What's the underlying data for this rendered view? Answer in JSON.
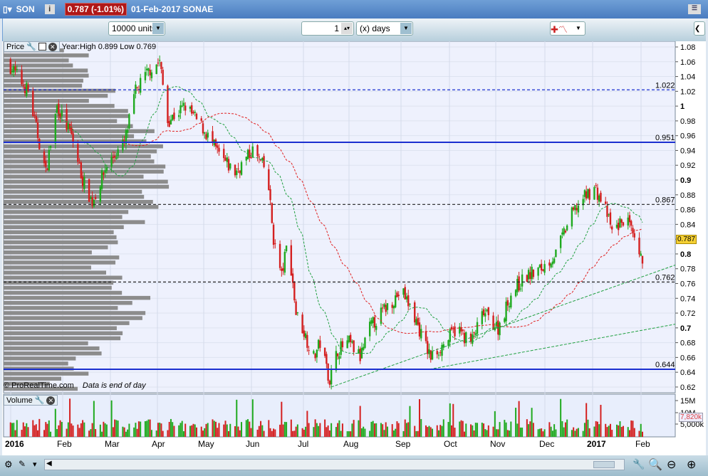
{
  "header": {
    "ticker": "SON",
    "price_change": "0.787 (-1.01%)",
    "date_name": "01-Feb-2017 SONAE"
  },
  "toolbar": {
    "units": "10000 units",
    "period_value": "1",
    "period_unit": "(x) days"
  },
  "price_panel": {
    "label": "Price",
    "year_info": "Year:High 0.899 Low 0.769",
    "footer": "© ProRealTime.com",
    "footer_note": "Data is end of day",
    "current_price": "0.787"
  },
  "volume_panel": {
    "label": "Volume",
    "current_volume": "7,820k",
    "axis": [
      "15M",
      "10M",
      "5,000k"
    ]
  },
  "y_axis": [
    "1.08",
    "1.06",
    "1.04",
    "1.02",
    "1",
    "0.98",
    "0.96",
    "0.94",
    "0.92",
    "0.9",
    "0.88",
    "0.86",
    "0.84",
    "0.82",
    "0.8",
    "0.78",
    "0.76",
    "0.74",
    "0.72",
    "0.7",
    "0.68",
    "0.66",
    "0.64",
    "0.62"
  ],
  "x_axis": [
    "2016",
    "Feb",
    "Mar",
    "Apr",
    "May",
    "Jun",
    "Jul",
    "Aug",
    "Sep",
    "Oct",
    "Nov",
    "Dec",
    "2017",
    "Feb"
  ],
  "levels": [
    {
      "value": 1.022,
      "label": "1.022",
      "style": "dashed",
      "color": "#1b2fd0"
    },
    {
      "value": 0.951,
      "label": "0.951",
      "style": "solid",
      "color": "#1b2fd0"
    },
    {
      "value": 0.867,
      "label": "0.867",
      "style": "dashed",
      "color": "#222222"
    },
    {
      "value": 0.762,
      "label": "0.762",
      "style": "dashed",
      "color": "#222222"
    },
    {
      "value": 0.644,
      "label": "0.644",
      "style": "solid",
      "color": "#1b2fd0"
    }
  ],
  "chart_data": {
    "type": "candlestick",
    "xlabel": "",
    "ylabel": "Price",
    "ylim": [
      0.61,
      1.085
    ],
    "path_days_since_2016_01_01": [
      1,
      14,
      25,
      32,
      41,
      48,
      54,
      63,
      74,
      81,
      90,
      96,
      101,
      112,
      123,
      134,
      143,
      154,
      163,
      167,
      172,
      176,
      181,
      185,
      192,
      196,
      202,
      207,
      214,
      221,
      227,
      238,
      247,
      254,
      261,
      265,
      274,
      281,
      290,
      298,
      307,
      316,
      325,
      334,
      343,
      352,
      358,
      367,
      374,
      378,
      387,
      394,
      397
    ],
    "path_close": [
      1.06,
      1.02,
      0.91,
      1.0,
      0.96,
      0.9,
      0.87,
      0.92,
      0.95,
      1.02,
      1.05,
      1.06,
      0.98,
      1.0,
      0.97,
      0.93,
      0.91,
      0.94,
      0.91,
      0.82,
      0.77,
      0.82,
      0.72,
      0.7,
      0.66,
      0.68,
      0.63,
      0.67,
      0.68,
      0.66,
      0.7,
      0.73,
      0.75,
      0.72,
      0.68,
      0.66,
      0.68,
      0.7,
      0.68,
      0.72,
      0.7,
      0.75,
      0.77,
      0.78,
      0.8,
      0.85,
      0.87,
      0.89,
      0.86,
      0.83,
      0.85,
      0.8,
      0.787
    ]
  },
  "colors": {
    "up": "#1faa1f",
    "down": "#d42020",
    "panel_bg": "#e8eefc"
  }
}
